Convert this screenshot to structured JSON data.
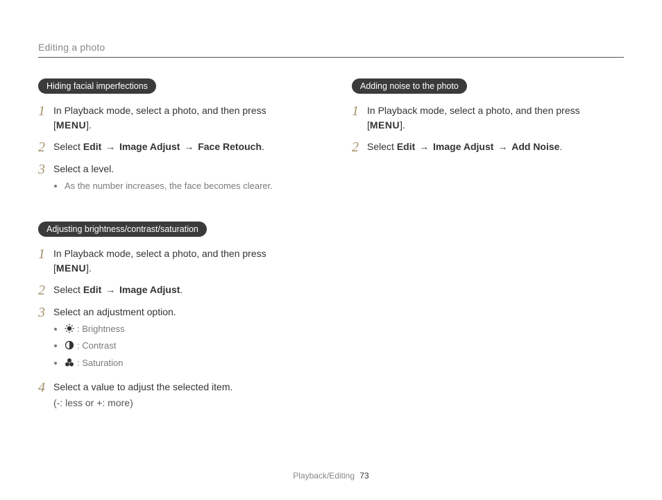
{
  "header": {
    "title": "Editing a photo"
  },
  "menu_label": "MENU",
  "arrow": "→",
  "left": {
    "section1": {
      "pill": "Hiding facial imperfections",
      "step1_a": "In Playback mode, select a photo, and then press",
      "step1_b_pre": "[",
      "step1_b_post": "].",
      "step2_a": "Select ",
      "step2_edit": "Edit",
      "step2_ia": "Image Adjust",
      "step2_fr": "Face Retouch",
      "step2_end": ".",
      "step3": "Select a level.",
      "step3_bullet": "As the number increases, the face becomes clearer."
    },
    "section2": {
      "pill": "Adjusting brightness/contrast/saturation",
      "step1_a": "In Playback mode, select a photo, and then press",
      "step1_b_pre": "[",
      "step1_b_post": "].",
      "step2_a": "Select ",
      "step2_edit": "Edit",
      "step2_ia": "Image Adjust",
      "step2_end": ".",
      "step3": "Select an adjustment option.",
      "opt_brightness": ": Brightness",
      "opt_contrast": ": Contrast",
      "opt_saturation": ": Saturation",
      "step4": "Select a value to adjust the selected item.",
      "step4_sub": "(-: less or +: more)"
    }
  },
  "right": {
    "section1": {
      "pill": "Adding noise to the photo",
      "step1_a": "In Playback mode, select a photo, and then press",
      "step1_b_pre": "[",
      "step1_b_post": "].",
      "step2_a": "Select ",
      "step2_edit": "Edit",
      "step2_ia": "Image Adjust",
      "step2_an": "Add Noise",
      "step2_end": "."
    }
  },
  "nums": {
    "n1": "1",
    "n2": "2",
    "n3": "3",
    "n4": "4"
  },
  "footer": {
    "section": "Playback/Editing",
    "page": "73"
  }
}
